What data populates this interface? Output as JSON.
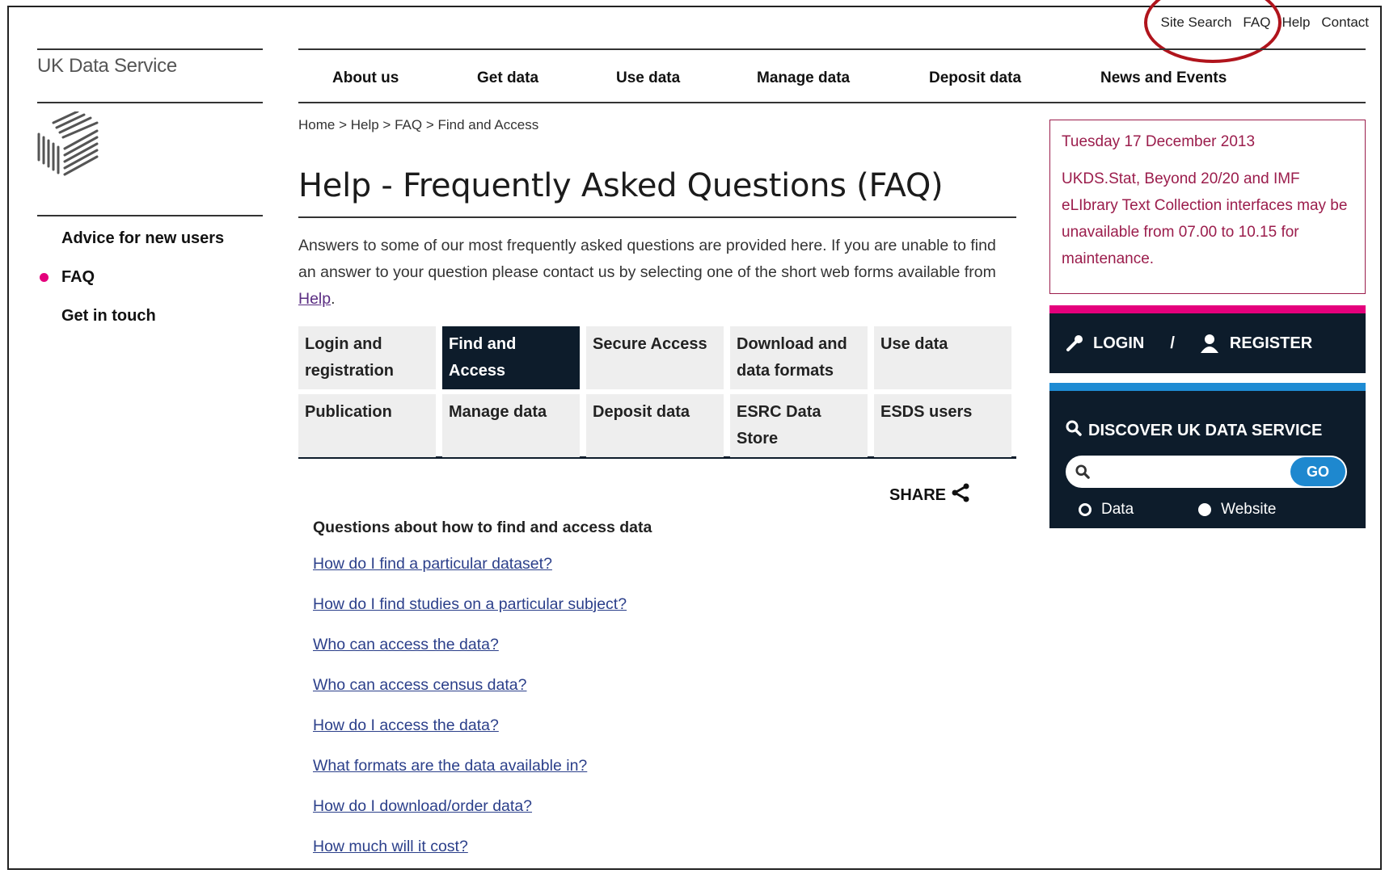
{
  "utility_links": [
    "Site Search",
    "FAQ",
    "Help",
    "Contact"
  ],
  "brand": "UK Data Service",
  "main_nav": [
    "About us",
    "Get data",
    "Use data",
    "Manage data",
    "Deposit data",
    "News and Events"
  ],
  "left_nav": {
    "items": [
      "Advice for new users",
      "FAQ",
      "Get in touch"
    ],
    "active": "FAQ"
  },
  "breadcrumb": [
    "Home",
    "Help",
    "FAQ",
    "Find and Access"
  ],
  "breadcrumb_sep": " > ",
  "page_title": "Help - Frequently Asked Questions (FAQ)",
  "intro": {
    "text_before": "Answers to some of our most frequently asked questions are provided here. If you are unable to find an answer to your question please contact us by selecting one of the short web forms available from ",
    "link": "Help",
    "text_after": "."
  },
  "tabs": [
    "Login and registration",
    "Find and Access",
    "Secure Access",
    "Download and data formats",
    "Use data",
    "Publication",
    "Manage data",
    "Deposit data",
    "ESRC Data Store",
    "ESDS users"
  ],
  "active_tab": "Find and Access",
  "share_label": "SHARE",
  "questions": {
    "heading": "Questions about how to find and access data",
    "links": [
      "How do I find a particular dataset?",
      "How do I find studies on a particular subject?",
      "Who can access the data?",
      "Who can access census data?",
      "How do I access the data?",
      "What formats are the data available in?",
      "How do I download/order data?",
      "How much will it cost?"
    ]
  },
  "notice": {
    "date": "Tuesday 17 December 2013",
    "message": "UKDS.Stat, Beyond 20/20 and IMF eLIbrary Text Collection interfaces may be unavailable from 07.00 to 10.15 for maintenance."
  },
  "account": {
    "login": "LOGIN",
    "separator": "/",
    "register": "REGISTER"
  },
  "discover": {
    "title": "DISCOVER UK DATA SERVICE",
    "search_value": "",
    "go": "GO",
    "options": [
      "Data",
      "Website"
    ],
    "selected": "Website"
  },
  "colors": {
    "accent_pink": "#e4007c",
    "navy": "#0d1c2b",
    "blue": "#1e88cf",
    "notice": "#9b1d4c",
    "annotation": "#b0141c"
  },
  "icons": [
    "logo-cube-icon",
    "key-icon",
    "add-user-icon",
    "search-icon",
    "share-icon"
  ]
}
